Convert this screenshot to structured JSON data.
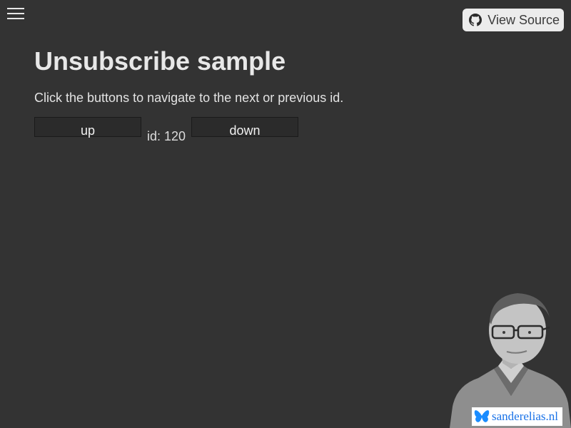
{
  "header": {
    "menu_icon": "hamburger-icon",
    "view_source_label": "View Source",
    "view_source_icon": "github-icon"
  },
  "main": {
    "title": "Unsubscribe sample",
    "intro": "Click the buttons to navigate to the next or previous id.",
    "up_label": "up",
    "id_text": "id: 120",
    "down_label": "down"
  },
  "footer": {
    "badge_icon": "butterfly-icon",
    "badge_text": "sanderelias.nl",
    "portrait_icon": "author-portrait"
  },
  "colors": {
    "background": "#333333",
    "text": "#e6e6e6",
    "button_bg": "#2b2b2b",
    "view_source_bg": "#ececec",
    "badge_link": "#1a73e8"
  }
}
